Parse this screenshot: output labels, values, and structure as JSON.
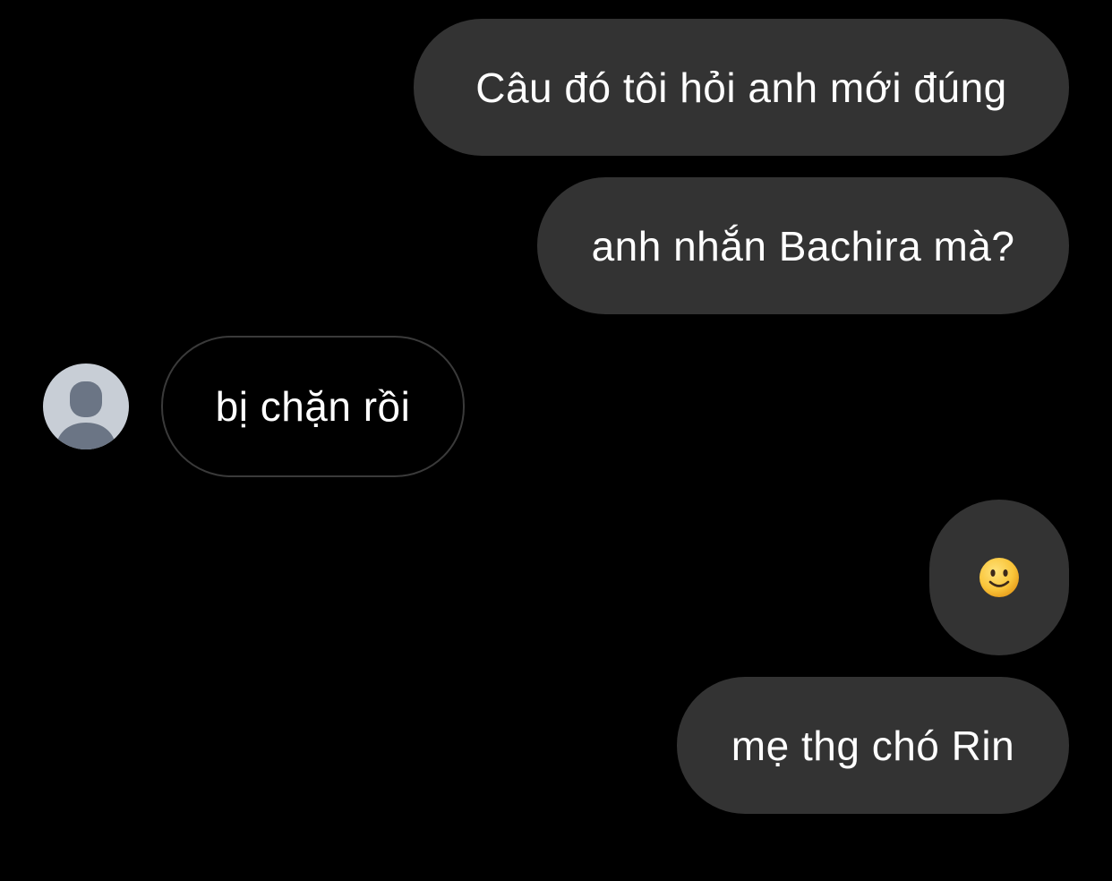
{
  "conversation": {
    "messages": [
      {
        "direction": "outgoing",
        "text": "Câu đó tôi hỏi anh mới đúng"
      },
      {
        "direction": "outgoing",
        "text": "anh nhắn Bachira mà?"
      },
      {
        "direction": "incoming",
        "text": "bị chặn rồi"
      },
      {
        "direction": "outgoing",
        "emoji": "slightly-smiling-face"
      },
      {
        "direction": "outgoing",
        "text": "mẹ thg chó Rin"
      }
    ]
  },
  "colors": {
    "background": "#000000",
    "outgoing_bubble": "#333333",
    "incoming_border": "#3a3a3a",
    "text": "#ffffff",
    "avatar_bg": "#c8ced6",
    "avatar_figure": "#6b7585"
  },
  "icons": {
    "avatar": "default-user-avatar-icon",
    "emoji": "slightly-smiling-face-icon"
  }
}
